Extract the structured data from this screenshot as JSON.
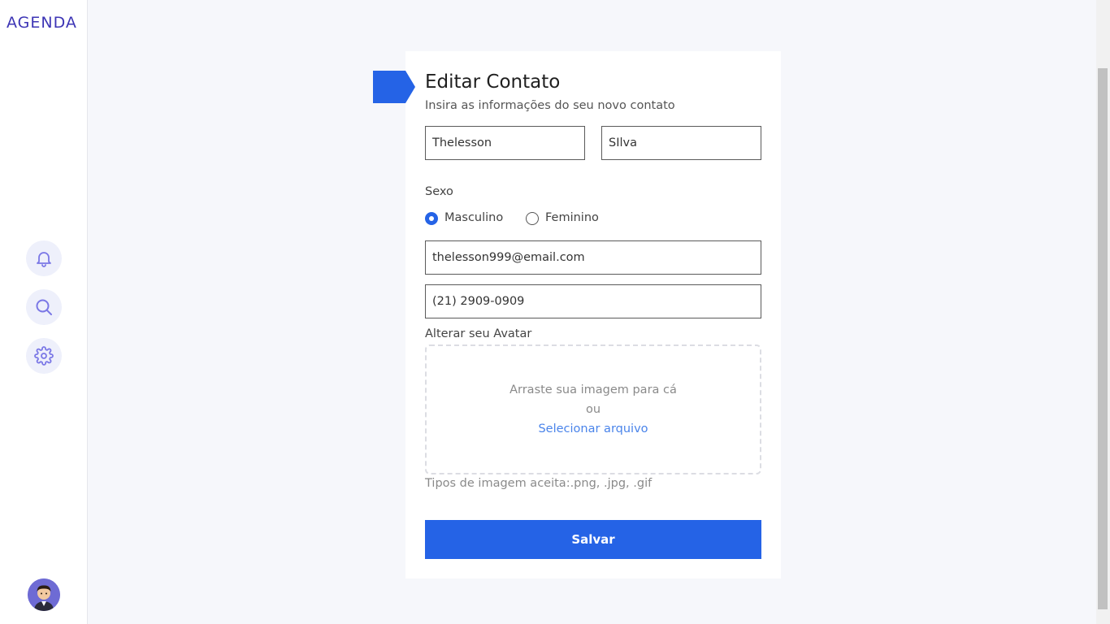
{
  "app": {
    "brand": "AGENDA"
  },
  "sidebar": {
    "icons": [
      "bell-icon",
      "search-icon",
      "gear-icon"
    ],
    "icon_color": "#7b78e6"
  },
  "form": {
    "title": "Editar Contato",
    "subtitle": "Insira as informações do seu novo contato",
    "first_name": "Thelesson",
    "last_name": "SIlva",
    "sex_label": "Sexo",
    "sex_options": [
      {
        "label": "Masculino",
        "checked": true
      },
      {
        "label": "Feminino",
        "checked": false
      }
    ],
    "email": "thelesson999@email.com",
    "phone": "(21) 2909-0909",
    "avatar_label": "Alterar seu Avatar",
    "dropzone": {
      "line1": "Arraste sua imagem para cá",
      "line2": "ou",
      "link": "Selecionar arquivo"
    },
    "accepted_types": "Tipos de imagem aceita:.png, .jpg, .gif",
    "save_label": "Salvar"
  },
  "colors": {
    "accent": "#2563e6",
    "brand": "#3d35b5",
    "link": "#4a84ea"
  }
}
